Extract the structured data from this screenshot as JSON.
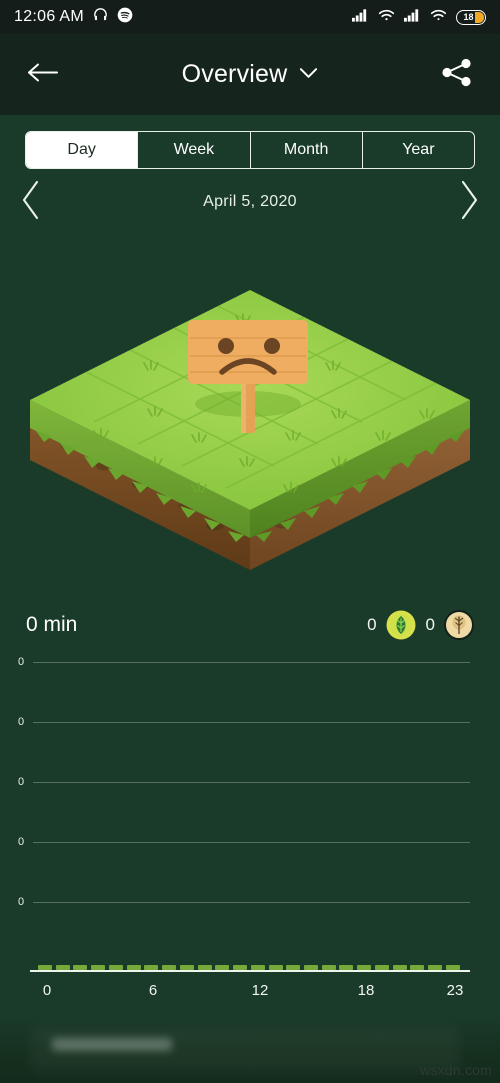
{
  "status_bar": {
    "time": "12:06 AM",
    "icons": [
      "headphones-icon",
      "spotify-icon"
    ],
    "right_icons": [
      "signal-bars-icon",
      "wifi-icon",
      "signal-bars-icon",
      "wifi-icon"
    ],
    "battery_percent": "18"
  },
  "app_bar": {
    "back_icon": "arrow-left-icon",
    "title": "Overview",
    "dropdown_icon": "chevron-down-icon",
    "share_icon": "share-icon"
  },
  "segmented_control": {
    "options": [
      {
        "label": "Day",
        "selected": true
      },
      {
        "label": "Week",
        "selected": false
      },
      {
        "label": "Month",
        "selected": false
      },
      {
        "label": "Year",
        "selected": false
      }
    ]
  },
  "date_nav": {
    "prev_icon": "chevron-left-icon",
    "date": "April 5, 2020",
    "next_icon": "chevron-right-icon"
  },
  "illustration": {
    "name": "isometric-grass-plot",
    "sign_face": "sad-face",
    "grass_color": "#8cc63f",
    "grass_top_light": "#9ed14d",
    "soil_color": "#8a5a2b",
    "sign_color": "#eead60"
  },
  "stats": {
    "duration": "0 min",
    "leaf_count": "0",
    "leaf_badge_icon": "leaf-badge-icon",
    "tree_count": "0",
    "tree_badge_icon": "tree-badge-icon",
    "leaf_badge_color": "#d8e04a",
    "tree_badge_color": "#efd9a4"
  },
  "chart_data": {
    "type": "bar",
    "title": "",
    "xlabel": "",
    "ylabel": "",
    "categories": [
      0,
      1,
      2,
      3,
      4,
      5,
      6,
      7,
      8,
      9,
      10,
      11,
      12,
      13,
      14,
      15,
      16,
      17,
      18,
      19,
      20,
      21,
      22,
      23
    ],
    "values": [
      0,
      0,
      0,
      0,
      0,
      0,
      0,
      0,
      0,
      0,
      0,
      0,
      0,
      0,
      0,
      0,
      0,
      0,
      0,
      0,
      0,
      0,
      0,
      0
    ],
    "y_tick_labels": [
      "0",
      "0",
      "0",
      "0",
      "0"
    ],
    "x_tick_labels": [
      "0",
      "6",
      "12",
      "18",
      "23"
    ],
    "x_tick_positions": [
      0,
      6,
      12,
      18,
      23
    ],
    "ylim": [
      0,
      0
    ],
    "grid": true,
    "legend": "none",
    "bar_color": "#76a83a"
  },
  "watermark": "wsxdn.com"
}
